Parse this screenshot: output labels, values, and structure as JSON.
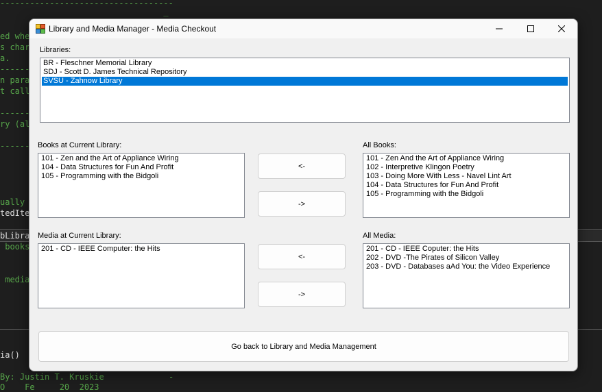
{
  "background_code": {
    "lines": [
      "-----------------------------------",
      "                                 _",
      "ed whe",
      "s char",
      "a.",
      "------",
      "n para",
      "t call",
      "------",
      "ry (al",
      "------",
      "ually",
      "tedIte",
      "bLibra",
      " books",
      " media",
      "ia()",
      "By: Justin T. Kruskie",
      "-",
      "O    Fe     20  2023"
    ]
  },
  "window": {
    "title": "Library and Media Manager - Media Checkout",
    "icon": "app-icon",
    "controls": [
      "minimize-icon",
      "maximize-icon",
      "close-icon"
    ]
  },
  "libraries": {
    "label": "Libraries:",
    "items": [
      "BR - Fleschner Memorial Library",
      "SDJ - Scott D. James Technical Repository",
      "SVSU - Zahnow Library"
    ],
    "selected_index": 2
  },
  "books_current": {
    "label": "Books at Current Library:",
    "items": [
      "101 - Zen and the Art of Appliance Wiring",
      "104 - Data Structures for Fun And Profit",
      "105 - Programming with the Bidgoli"
    ]
  },
  "books_all": {
    "label": "All Books:",
    "items": [
      "101 - Zen And the Art of Appliance Wiring",
      "102 - Interpretive Klingon Poetry",
      "103 - Doing More With Less - Navel Lint Art",
      "104 - Data Structures for Fun And Profit",
      "105 - Programming with the Bidgoli"
    ]
  },
  "media_current": {
    "label": "Media at Current Library:",
    "items": [
      "201 - CD - IEEE Computer: the Hits"
    ]
  },
  "media_all": {
    "label": "All Media:",
    "items": [
      "201 - CD - IEEE Coputer: the Hits",
      "202 - DVD -The Pirates of Silicon Valley",
      "203 - DVD - Databases aAd You: the Video Experience"
    ]
  },
  "buttons": {
    "book_checkout": "<-",
    "book_return": "->",
    "media_checkout": "<-",
    "media_return": "->",
    "go_back": "Go back to Library and Media Management"
  },
  "colors": {
    "selection": "#0078d7",
    "window_bg": "#f0f0f0",
    "editor_bg": "#1e1e1e",
    "comment_green": "#57a64a"
  }
}
